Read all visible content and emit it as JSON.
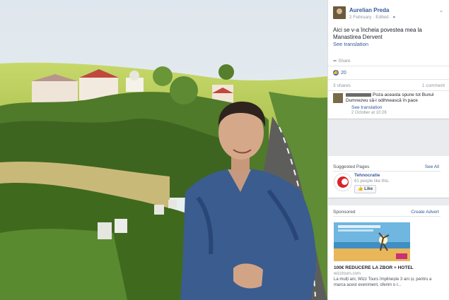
{
  "post": {
    "author": "Aurelian Preda",
    "meta": "2 February · Edited ·",
    "text": "Aici se v-a încheia povestea mea la Manastirea Dervent",
    "see_translation": "See translation",
    "share_label": "Share",
    "like_count": "20",
    "shares": "3 shares",
    "comments_count": "1 comment"
  },
  "comment": {
    "text": "Poza aceasta spune tot Bunul Dumnezeu să-l odihnească în pace",
    "see_translation": "See translation",
    "time": "2 October at 10:26"
  },
  "suggested": {
    "header": "Suggested Pages",
    "see_all": "See All",
    "page_name": "Tehnocratie",
    "page_likes": "61 people like this.",
    "like_button": "Like"
  },
  "sponsored": {
    "header": "Sponsored",
    "create_advert": "Create Advert",
    "ad_title": "100€ REDUCERE LA ZBOR + HOTEL",
    "ad_domain": "wizztours.com",
    "ad_desc": "La mulți ani, Wizz Tours împlinește 3 ani și, pentru a marca acest eveniment, oferim o r..."
  },
  "colors": {
    "link": "#365899",
    "like_blue": "#4267b2"
  }
}
